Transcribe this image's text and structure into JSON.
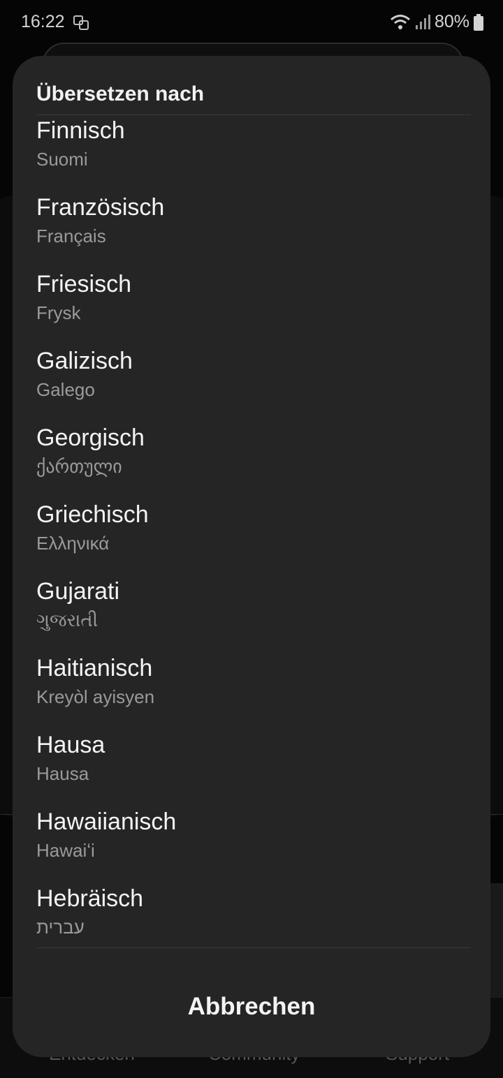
{
  "status_bar": {
    "time": "16:22",
    "battery": "80%",
    "icons": [
      "notification-icon",
      "wifi-icon",
      "signal-icon",
      "battery-icon"
    ]
  },
  "background": {
    "nav_labels": [
      "Entdecken",
      "Community",
      "Support"
    ]
  },
  "dialog": {
    "title": "Übersetzen nach",
    "languages": [
      {
        "name": "Finnisch",
        "native": "Suomi"
      },
      {
        "name": "Französisch",
        "native": "Français"
      },
      {
        "name": "Friesisch",
        "native": "Frysk"
      },
      {
        "name": "Galizisch",
        "native": "Galego"
      },
      {
        "name": "Georgisch",
        "native": "ქართული"
      },
      {
        "name": "Griechisch",
        "native": "Ελληνικά"
      },
      {
        "name": "Gujarati",
        "native": "ગુજરાતી"
      },
      {
        "name": "Haitianisch",
        "native": "Kreyòl ayisyen"
      },
      {
        "name": "Hausa",
        "native": "Hausa"
      },
      {
        "name": "Hawaiianisch",
        "native": "Hawaiʻi"
      },
      {
        "name": "Hebräisch",
        "native": "עברית"
      }
    ],
    "cancel_label": "Abbrechen"
  }
}
